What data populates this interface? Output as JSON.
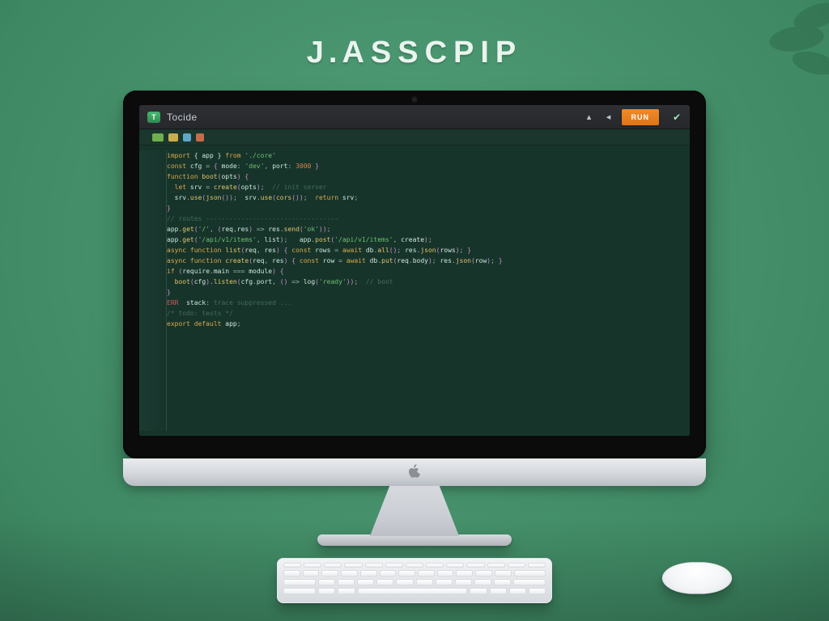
{
  "hero": {
    "prefix": "J.",
    "word": "ASSCPIP"
  },
  "app": {
    "brand_mark": "T",
    "title": "Tocide",
    "run_label": "RUN"
  },
  "code": {
    "lines": [
      [
        [
          "kw",
          "import"
        ],
        [
          "op",
          " "
        ],
        [
          "id",
          "{ app }"
        ],
        [
          "op",
          " "
        ],
        [
          "kw",
          "from"
        ],
        [
          "op",
          " "
        ],
        [
          "str",
          "'./core'"
        ]
      ],
      [
        [
          "kw",
          "const"
        ],
        [
          "op",
          " "
        ],
        [
          "id",
          "cfg"
        ],
        [
          "op",
          " "
        ],
        [
          "op",
          "="
        ],
        [
          "op",
          " "
        ],
        [
          "brk",
          "{"
        ],
        [
          "op",
          " "
        ],
        [
          "id",
          "mode"
        ],
        [
          "op",
          ":"
        ],
        [
          "op",
          " "
        ],
        [
          "str",
          "'dev'"
        ],
        [
          "op",
          ","
        ],
        [
          "op",
          " "
        ],
        [
          "id",
          "port"
        ],
        [
          "op",
          ":"
        ],
        [
          "op",
          " "
        ],
        [
          "num",
          "3000"
        ],
        [
          "op",
          " "
        ],
        [
          "brk",
          "}"
        ]
      ],
      [
        [
          "kw",
          "function"
        ],
        [
          "op",
          " "
        ],
        [
          "fn",
          "boot"
        ],
        [
          "brk",
          "("
        ],
        [
          "id",
          "opts"
        ],
        [
          "brk",
          ")"
        ],
        [
          "op",
          " "
        ],
        [
          "brk",
          "{"
        ]
      ],
      [
        [
          "op",
          "  "
        ],
        [
          "kw",
          "let"
        ],
        [
          "op",
          " "
        ],
        [
          "id",
          "srv"
        ],
        [
          "op",
          " "
        ],
        [
          "op",
          "="
        ],
        [
          "op",
          " "
        ],
        [
          "fn",
          "create"
        ],
        [
          "brk",
          "("
        ],
        [
          "id",
          "opts"
        ],
        [
          "brk",
          ")"
        ],
        [
          "op",
          ";"
        ],
        [
          "op",
          "  "
        ],
        [
          "com",
          "// init server"
        ]
      ],
      [
        [
          "op",
          "  "
        ],
        [
          "id",
          "srv"
        ],
        [
          "op",
          "."
        ],
        [
          "fn",
          "use"
        ],
        [
          "brk",
          "("
        ],
        [
          "fn",
          "json"
        ],
        [
          "brk",
          "()"
        ],
        [
          "brk",
          ")"
        ],
        [
          "op",
          ";"
        ],
        [
          "op",
          "  "
        ],
        [
          "id",
          "srv"
        ],
        [
          "op",
          "."
        ],
        [
          "fn",
          "use"
        ],
        [
          "brk",
          "("
        ],
        [
          "fn",
          "cors"
        ],
        [
          "brk",
          "()"
        ],
        [
          "brk",
          ")"
        ],
        [
          "op",
          ";"
        ],
        [
          "op",
          "  "
        ],
        [
          "kw",
          "return"
        ],
        [
          "op",
          " "
        ],
        [
          "id",
          "srv"
        ],
        [
          "op",
          ";"
        ]
      ],
      [
        [
          "brk",
          "}"
        ]
      ],
      [
        [
          "com",
          "// routes ----------------------------------"
        ]
      ],
      [
        [
          "id",
          "app"
        ],
        [
          "op",
          "."
        ],
        [
          "fn",
          "get"
        ],
        [
          "brk",
          "("
        ],
        [
          "str",
          "'/'"
        ],
        [
          "op",
          ","
        ],
        [
          "op",
          " "
        ],
        [
          "brk",
          "("
        ],
        [
          "id",
          "req"
        ],
        [
          "op",
          ","
        ],
        [
          "id",
          "res"
        ],
        [
          "brk",
          ")"
        ],
        [
          "op",
          " "
        ],
        [
          "op",
          "=>"
        ],
        [
          "op",
          " "
        ],
        [
          "id",
          "res"
        ],
        [
          "op",
          "."
        ],
        [
          "fn",
          "send"
        ],
        [
          "brk",
          "("
        ],
        [
          "str",
          "'ok'"
        ],
        [
          "brk",
          "))"
        ],
        [
          "op",
          ";"
        ]
      ],
      [
        [
          "id",
          "app"
        ],
        [
          "op",
          "."
        ],
        [
          "fn",
          "get"
        ],
        [
          "brk",
          "("
        ],
        [
          "str",
          "'/api/v1/items'"
        ],
        [
          "op",
          ","
        ],
        [
          "op",
          " "
        ],
        [
          "id",
          "list"
        ],
        [
          "brk",
          ")"
        ],
        [
          "op",
          ";"
        ],
        [
          "op",
          "   "
        ],
        [
          "id",
          "app"
        ],
        [
          "op",
          "."
        ],
        [
          "fn",
          "post"
        ],
        [
          "brk",
          "("
        ],
        [
          "str",
          "'/api/v1/items'"
        ],
        [
          "op",
          ","
        ],
        [
          "op",
          " "
        ],
        [
          "id",
          "create"
        ],
        [
          "brk",
          ")"
        ],
        [
          "op",
          ";"
        ]
      ],
      [
        [
          "op",
          ""
        ]
      ],
      [
        [
          "kw",
          "async"
        ],
        [
          "op",
          " "
        ],
        [
          "kw",
          "function"
        ],
        [
          "op",
          " "
        ],
        [
          "fn",
          "list"
        ],
        [
          "brk",
          "("
        ],
        [
          "id",
          "req"
        ],
        [
          "op",
          ","
        ],
        [
          "op",
          " "
        ],
        [
          "id",
          "res"
        ],
        [
          "brk",
          ")"
        ],
        [
          "op",
          " "
        ],
        [
          "brk",
          "{"
        ],
        [
          "op",
          " "
        ],
        [
          "kw",
          "const"
        ],
        [
          "op",
          " "
        ],
        [
          "id",
          "rows"
        ],
        [
          "op",
          " "
        ],
        [
          "op",
          "="
        ],
        [
          "op",
          " "
        ],
        [
          "kw",
          "await"
        ],
        [
          "op",
          " "
        ],
        [
          "id",
          "db"
        ],
        [
          "op",
          "."
        ],
        [
          "fn",
          "all"
        ],
        [
          "brk",
          "()"
        ],
        [
          "op",
          ";"
        ],
        [
          "op",
          " "
        ],
        [
          "id",
          "res"
        ],
        [
          "op",
          "."
        ],
        [
          "fn",
          "json"
        ],
        [
          "brk",
          "("
        ],
        [
          "id",
          "rows"
        ],
        [
          "brk",
          ")"
        ],
        [
          "op",
          ";"
        ],
        [
          "op",
          " "
        ],
        [
          "brk",
          "}"
        ]
      ],
      [
        [
          "kw",
          "async"
        ],
        [
          "op",
          " "
        ],
        [
          "kw",
          "function"
        ],
        [
          "op",
          " "
        ],
        [
          "fn",
          "create"
        ],
        [
          "brk",
          "("
        ],
        [
          "id",
          "req"
        ],
        [
          "op",
          ","
        ],
        [
          "op",
          " "
        ],
        [
          "id",
          "res"
        ],
        [
          "brk",
          ")"
        ],
        [
          "op",
          " "
        ],
        [
          "brk",
          "{"
        ],
        [
          "op",
          " "
        ],
        [
          "kw",
          "const"
        ],
        [
          "op",
          " "
        ],
        [
          "id",
          "row"
        ],
        [
          "op",
          " "
        ],
        [
          "op",
          "="
        ],
        [
          "op",
          " "
        ],
        [
          "kw",
          "await"
        ],
        [
          "op",
          " "
        ],
        [
          "id",
          "db"
        ],
        [
          "op",
          "."
        ],
        [
          "fn",
          "put"
        ],
        [
          "brk",
          "("
        ],
        [
          "id",
          "req"
        ],
        [
          "op",
          "."
        ],
        [
          "id",
          "body"
        ],
        [
          "brk",
          ")"
        ],
        [
          "op",
          ";"
        ],
        [
          "op",
          " "
        ],
        [
          "id",
          "res"
        ],
        [
          "op",
          "."
        ],
        [
          "fn",
          "json"
        ],
        [
          "brk",
          "("
        ],
        [
          "id",
          "row"
        ],
        [
          "brk",
          ")"
        ],
        [
          "op",
          ";"
        ],
        [
          "op",
          " "
        ],
        [
          "brk",
          "}"
        ]
      ],
      [
        [
          "op",
          ""
        ]
      ],
      [
        [
          "kw",
          "if"
        ],
        [
          "op",
          " "
        ],
        [
          "brk",
          "("
        ],
        [
          "id",
          "require"
        ],
        [
          "op",
          "."
        ],
        [
          "id",
          "main"
        ],
        [
          "op",
          " "
        ],
        [
          "op",
          "==="
        ],
        [
          "op",
          " "
        ],
        [
          "id",
          "module"
        ],
        [
          "brk",
          ")"
        ],
        [
          "op",
          " "
        ],
        [
          "brk",
          "{"
        ]
      ],
      [
        [
          "op",
          "  "
        ],
        [
          "fn",
          "boot"
        ],
        [
          "brk",
          "("
        ],
        [
          "id",
          "cfg"
        ],
        [
          "brk",
          ")"
        ],
        [
          "op",
          "."
        ],
        [
          "fn",
          "listen"
        ],
        [
          "brk",
          "("
        ],
        [
          "id",
          "cfg"
        ],
        [
          "op",
          "."
        ],
        [
          "id",
          "port"
        ],
        [
          "op",
          ","
        ],
        [
          "op",
          " "
        ],
        [
          "brk",
          "()"
        ],
        [
          "op",
          " "
        ],
        [
          "op",
          "=>"
        ],
        [
          "op",
          " "
        ],
        [
          "id",
          "log"
        ],
        [
          "brk",
          "("
        ],
        [
          "str",
          "'ready'"
        ],
        [
          "brk",
          "))"
        ],
        [
          "op",
          ";"
        ],
        [
          "op",
          "  "
        ],
        [
          "com",
          "// boot"
        ]
      ],
      [
        [
          "brk",
          "}"
        ]
      ],
      [
        [
          "op",
          ""
        ]
      ],
      [
        [
          "err",
          "ERR"
        ],
        [
          "op",
          "  "
        ],
        [
          "id",
          "stack"
        ],
        [
          "op",
          ":"
        ],
        [
          "op",
          " "
        ],
        [
          "com",
          "trace suppressed ..."
        ]
      ],
      [
        [
          "op",
          ""
        ]
      ],
      [
        [
          "com",
          "/* todo: tests */"
        ]
      ],
      [
        [
          "op",
          ""
        ]
      ],
      [
        [
          "kw",
          "export"
        ],
        [
          "op",
          " "
        ],
        [
          "kw",
          "default"
        ],
        [
          "op",
          " "
        ],
        [
          "id",
          "app"
        ],
        [
          "op",
          ";"
        ]
      ]
    ]
  }
}
